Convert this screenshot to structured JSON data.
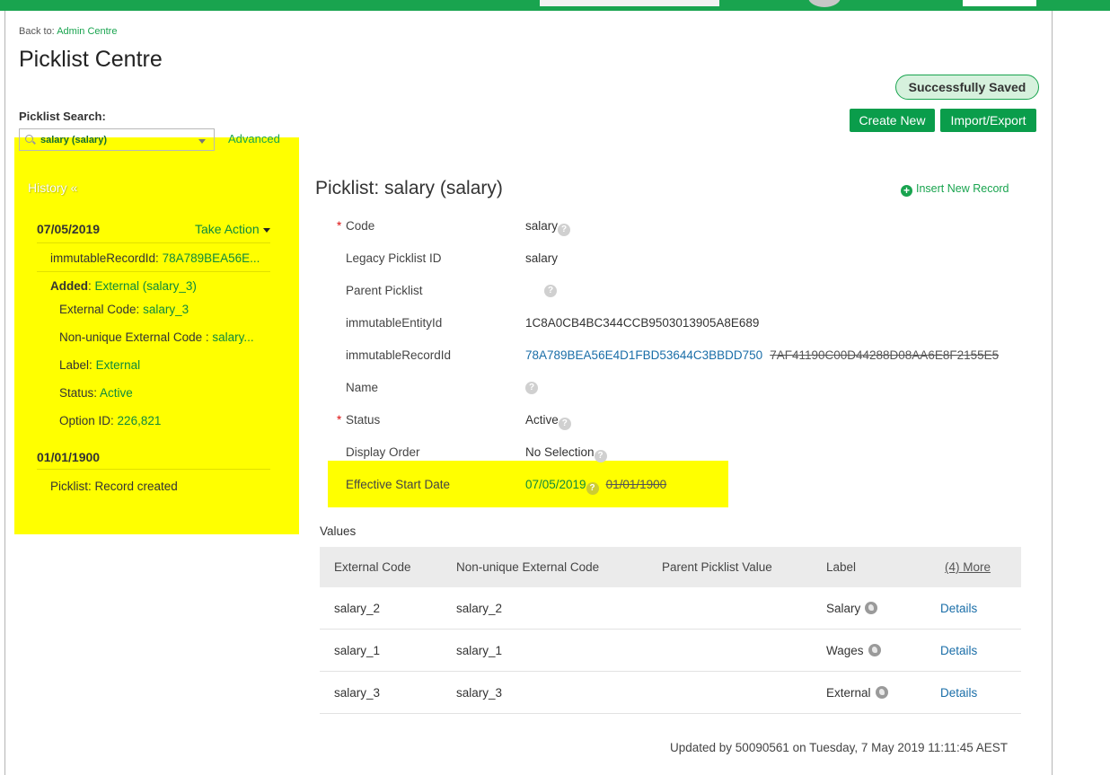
{
  "header": {
    "back_prefix": "Back to:",
    "back_link": "Admin Centre",
    "title": "Picklist Centre"
  },
  "status_badge": "Successfully Saved",
  "actions": {
    "create_new": "Create New",
    "import_export": "Import/Export"
  },
  "search": {
    "label": "Picklist Search:",
    "value": "salary (salary)",
    "advanced": "Advanced"
  },
  "history": {
    "heading": "History «",
    "entries": [
      {
        "date": "07/05/2019",
        "action": "Take Action",
        "immutable_label": "immutableRecordId:",
        "immutable_value": "78A789BEA56E...",
        "added_label": "Added",
        "added_value": "External (salary_3)",
        "details": [
          {
            "label": "External Code:",
            "value": "salary_3"
          },
          {
            "label": "Non-unique External Code :",
            "value": "salary..."
          },
          {
            "label": "Label:",
            "value": "External"
          },
          {
            "label": "Status:",
            "value": "Active"
          },
          {
            "label": "Option ID:",
            "value": "226,821"
          }
        ]
      },
      {
        "date": "01/01/1900",
        "note": "Picklist: Record created"
      }
    ]
  },
  "picklist": {
    "title": "Picklist: salary (salary)",
    "insert_link": "Insert New Record",
    "fields": {
      "code": {
        "label": "Code",
        "value": "salary"
      },
      "legacy": {
        "label": "Legacy Picklist ID",
        "value": "salary"
      },
      "parent": {
        "label": "Parent Picklist",
        "value": ""
      },
      "entity": {
        "label": "immutableEntityId",
        "value": "1C8A0CB4BC344CCB9503013905A8E689"
      },
      "record": {
        "label": "immutableRecordId",
        "value": "78A789BEA56E4D1FBD53644C3BBDD750",
        "old": "7AF41190C00D44288D08AA6E8F2155E5"
      },
      "name": {
        "label": "Name",
        "value": ""
      },
      "status": {
        "label": "Status",
        "value": "Active"
      },
      "display_order": {
        "label": "Display Order",
        "value": "No Selection"
      },
      "start_date": {
        "label": "Effective Start Date",
        "value": "07/05/2019",
        "old": "01/01/1900"
      }
    },
    "required_mark": "*"
  },
  "values": {
    "label": "Values",
    "columns": [
      "External Code",
      "Non-unique External Code",
      "Parent Picklist Value",
      "Label",
      "(4) More"
    ],
    "rows": [
      {
        "external_code": "salary_2",
        "non_unique": "salary_2",
        "parent": "",
        "label": "Salary",
        "link": "Details"
      },
      {
        "external_code": "salary_1",
        "non_unique": "salary_1",
        "parent": "",
        "label": "Wages",
        "link": "Details"
      },
      {
        "external_code": "salary_3",
        "non_unique": "salary_3",
        "parent": "",
        "label": "External",
        "link": "Details"
      }
    ]
  },
  "footer": "Updated by 50090561 on Tuesday, 7 May 2019 11:11:45 AEST",
  "icons": {
    "help": "question-mark-icon",
    "globe": "globe-icon",
    "insert": "plus-circle-icon",
    "search": "search-icon"
  },
  "colors": {
    "brand_green": "#19a44f",
    "highlight_yellow": "#ffff00",
    "link_blue": "#1a6ea8"
  }
}
